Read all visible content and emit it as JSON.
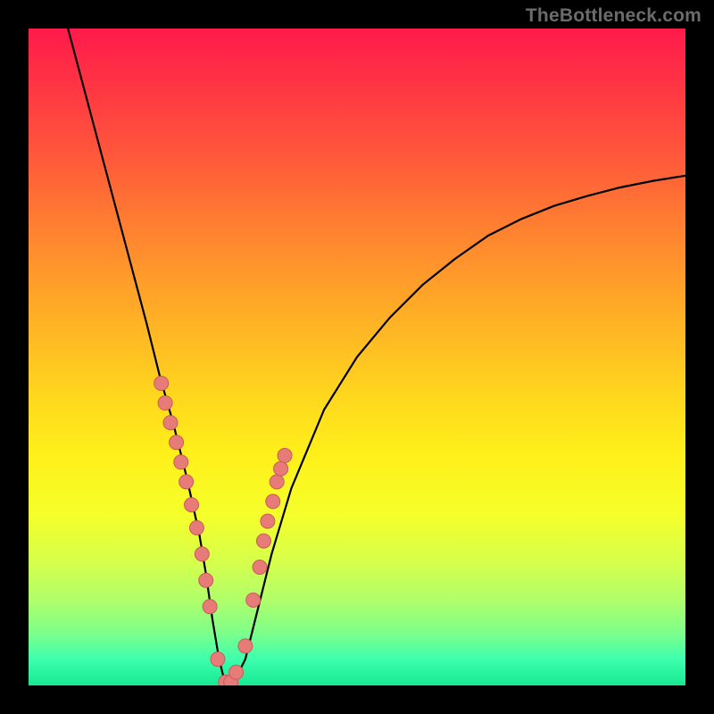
{
  "watermark": "TheBottleneck.com",
  "chart_data": {
    "type": "line",
    "title": "",
    "xlabel": "",
    "ylabel": "",
    "xlim": [
      0,
      100
    ],
    "ylim": [
      0,
      100
    ],
    "series": [
      {
        "name": "bottleneck-curve",
        "x": [
          6,
          10,
          14,
          18,
          20,
          22,
          24,
          26,
          27,
          28,
          29,
          30,
          31,
          33,
          35,
          37,
          40,
          45,
          50,
          55,
          60,
          65,
          70,
          75,
          80,
          85,
          90,
          95,
          100
        ],
        "y": [
          100,
          85,
          70,
          55,
          47,
          40,
          32,
          23,
          17,
          10,
          4,
          0,
          0,
          4,
          12,
          20,
          30,
          42,
          50,
          56,
          61,
          65,
          68.5,
          71,
          73,
          74.5,
          75.8,
          76.8,
          77.6
        ]
      }
    ],
    "markers": {
      "name": "highlight-points",
      "x": [
        20.2,
        20.8,
        21.6,
        22.5,
        23.2,
        24.0,
        24.8,
        25.6,
        26.4,
        27.0,
        27.6,
        28.8,
        30.0,
        30.8,
        31.6,
        33.0,
        34.2,
        35.2,
        35.8,
        36.4,
        37.2,
        37.8,
        38.4,
        39.0
      ],
      "y": [
        46,
        43,
        40,
        37,
        34,
        31,
        27.5,
        24,
        20,
        16,
        12,
        4,
        0.5,
        0.5,
        2,
        6,
        13,
        18,
        22,
        25,
        28,
        31,
        33,
        35
      ]
    },
    "gradient_stops": [
      {
        "pos": 0,
        "color": "#ff1a4b"
      },
      {
        "pos": 8,
        "color": "#ff3344"
      },
      {
        "pos": 20,
        "color": "#ff5a3a"
      },
      {
        "pos": 33,
        "color": "#ff8a2e"
      },
      {
        "pos": 45,
        "color": "#ffb325"
      },
      {
        "pos": 55,
        "color": "#ffd41e"
      },
      {
        "pos": 65,
        "color": "#fff01a"
      },
      {
        "pos": 74,
        "color": "#f5ff2a"
      },
      {
        "pos": 81,
        "color": "#d7ff4a"
      },
      {
        "pos": 87,
        "color": "#b0ff6a"
      },
      {
        "pos": 92,
        "color": "#7dff8a"
      },
      {
        "pos": 96,
        "color": "#3dffad"
      },
      {
        "pos": 100,
        "color": "#17e892"
      }
    ],
    "colors": {
      "curve": "#000000",
      "marker_fill": "#e77b78",
      "marker_stroke": "#c85c5a",
      "frame": "#000000"
    }
  }
}
